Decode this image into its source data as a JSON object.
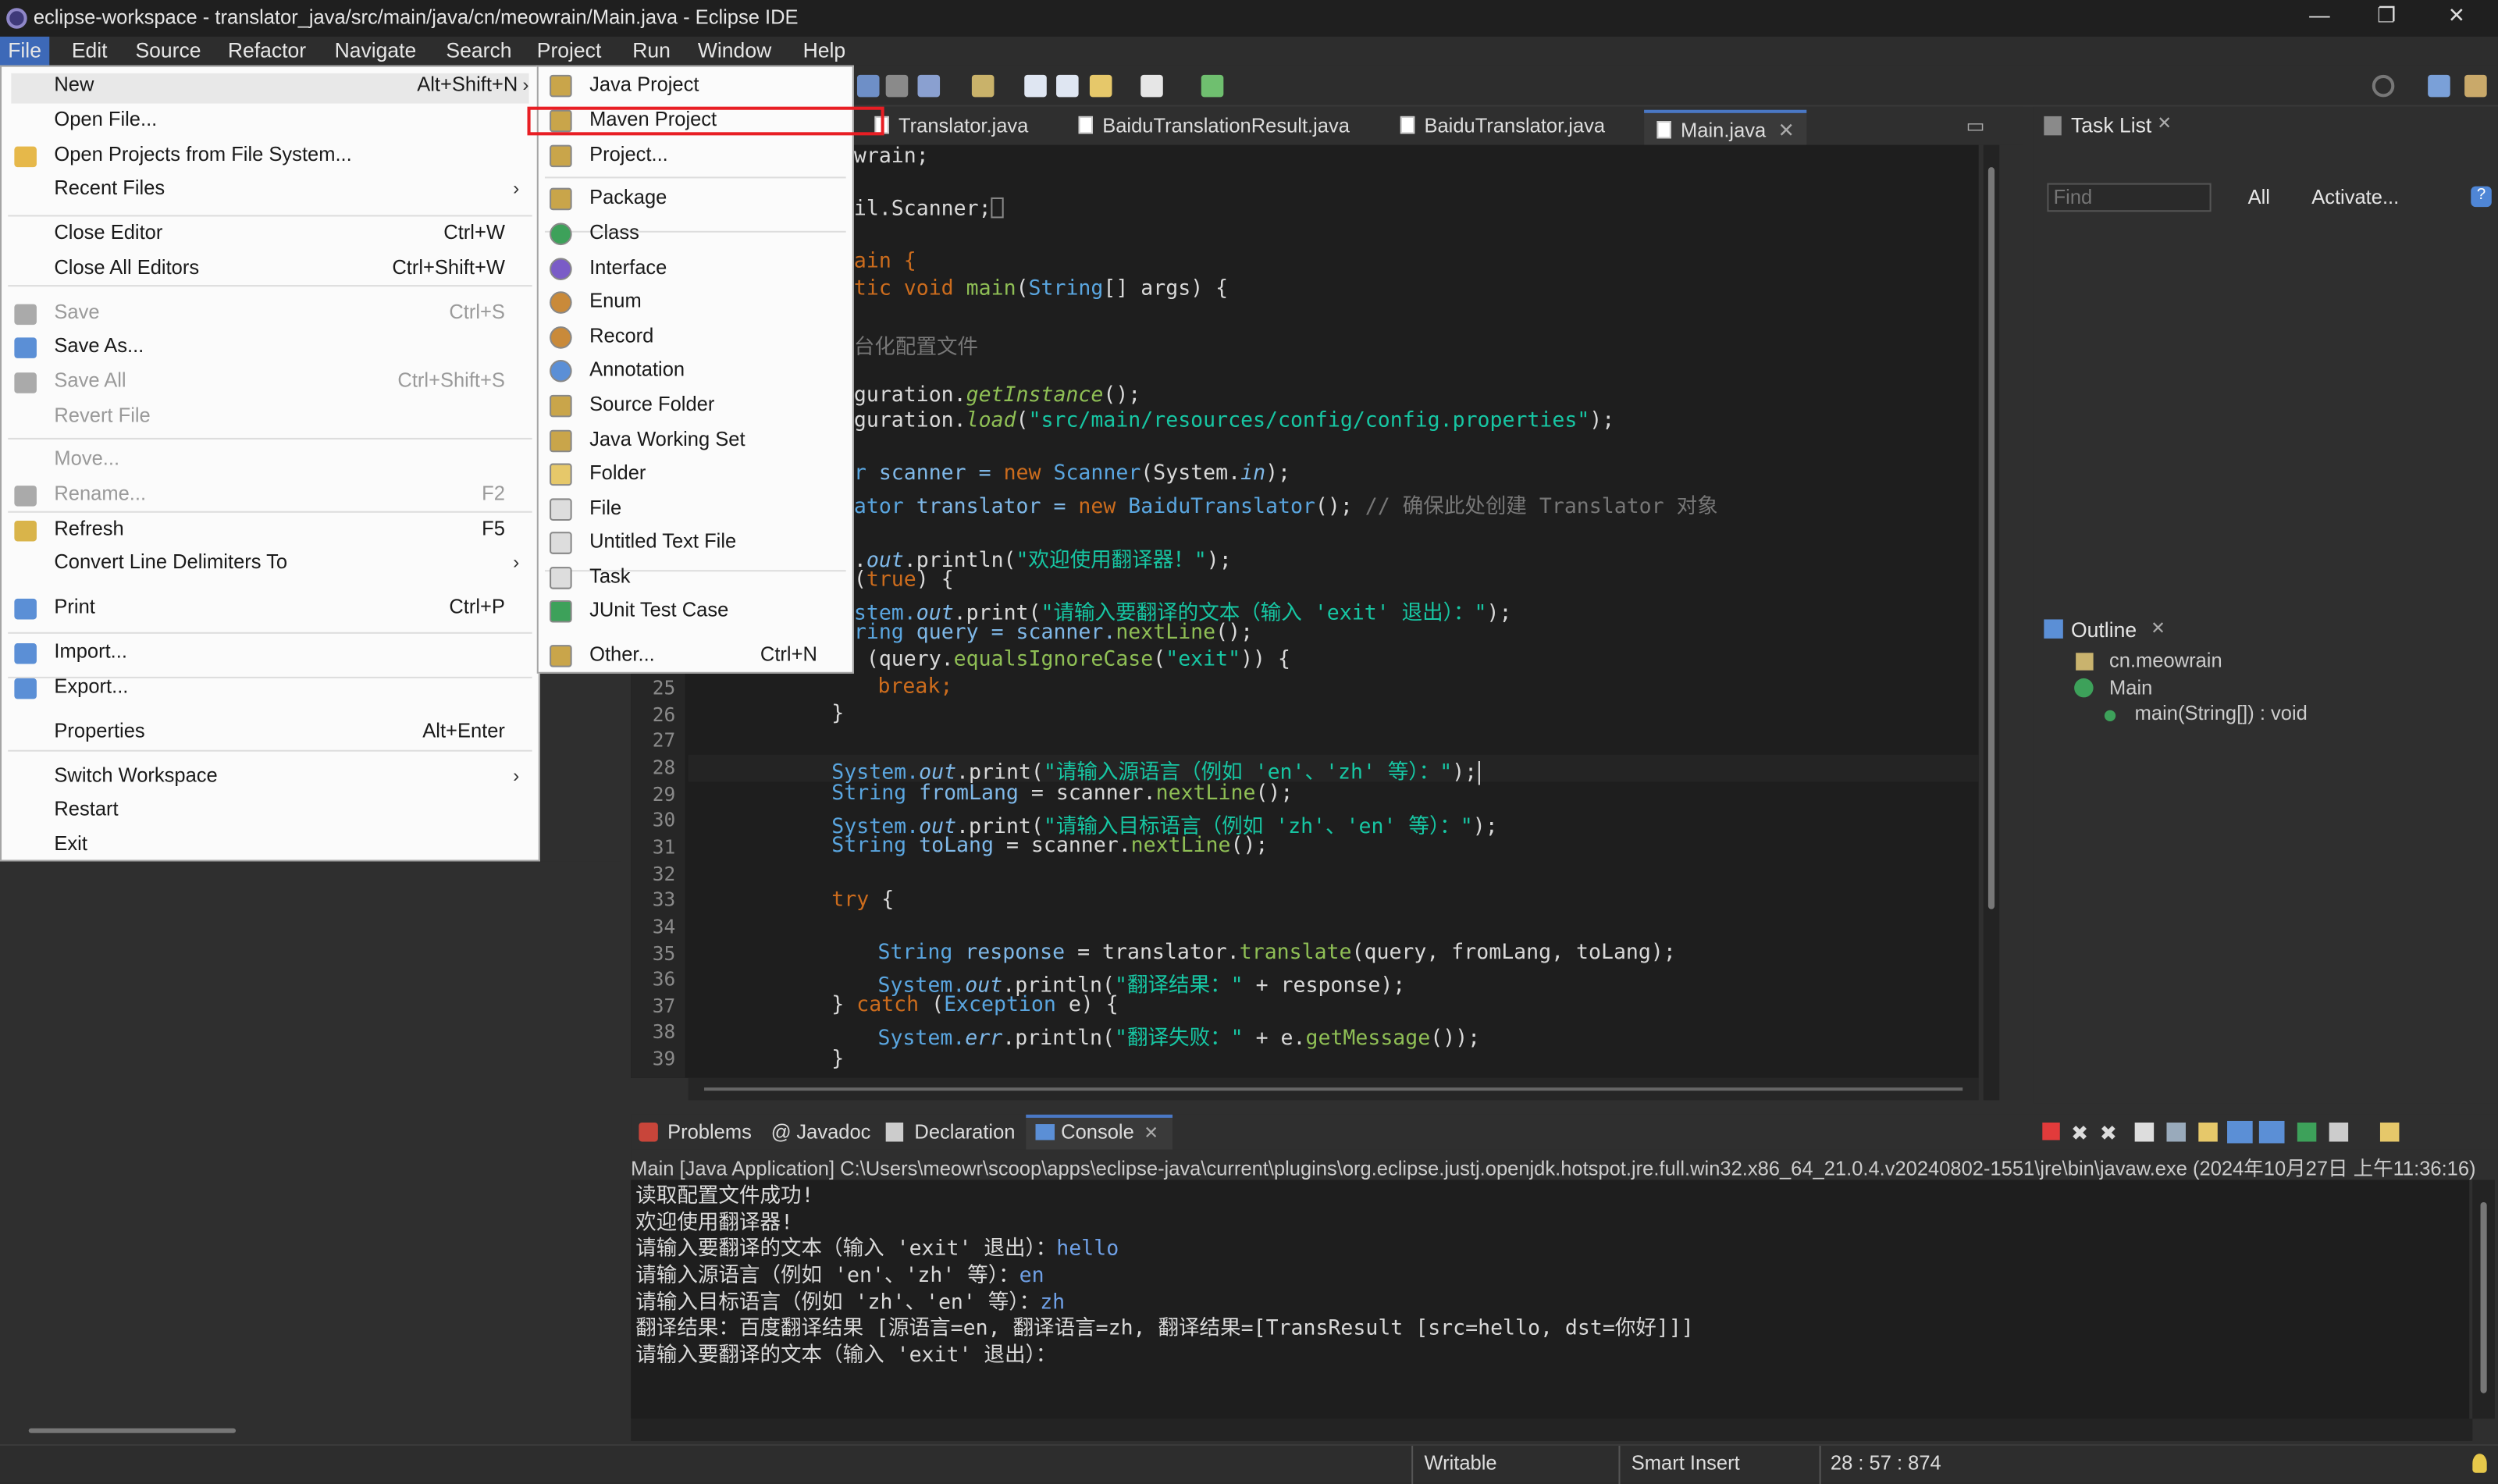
{
  "window": {
    "title": "eclipse-workspace - translator_java/src/main/java/cn/meowrain/Main.java - Eclipse IDE",
    "minimize": "—",
    "maximize": "❐",
    "close": "✕"
  },
  "menubar": [
    "File",
    "Edit",
    "Source",
    "Refactor",
    "Navigate",
    "Search",
    "Project",
    "Run",
    "Window",
    "Help"
  ],
  "editor_tabs": [
    "Translator.java",
    "BaiduTranslationResult.java",
    "BaiduTranslator.java",
    "Main.java"
  ],
  "close_glyph": "✕",
  "code": {
    "lines": [
      "25",
      "26",
      "27",
      "28",
      "29",
      "30",
      "31",
      "32",
      "33",
      "34",
      "35",
      "36",
      "37",
      "38",
      "39"
    ],
    "fragments": {
      "l1": "wrain;",
      "l2": "il.Scanner;",
      "l3a": "ain {",
      "l3b_kw": "tic void ",
      "l3b_fn": "main",
      "l3b_rest": "(",
      "l3b_ty": "String",
      "l3b_rest2": "[] args) {",
      "l4": "台化配置文件",
      "l5a": "guration.",
      "l5b": "getInstance",
      "l5c": "();",
      "l6a": "guration.",
      "l6b": "load",
      "l6c": "(",
      "l6d": "\"src/main/resources/config/config.properties\"",
      "l6e": ");",
      "l7a": "r ",
      "l7b": "scanner = ",
      "l7c": "new ",
      "l7d": "Scanner",
      "l7e": "(System.",
      "l7f": "in",
      "l7g": ");",
      "l8a": "ator ",
      "l8b": "translator = ",
      "l8c": "new ",
      "l8d": "BaiduTranslator",
      "l8e": "(); ",
      "l8f": "// 确保此处创建 Translator 对象",
      "l9a": ".",
      "l9b": "out",
      "l9c": ".println(",
      "l9d": "\"欢迎使用翻译器！\"",
      "l9e": ");",
      "l10a": "(",
      "l10b": "true",
      "l10c": ") {",
      "l11a": "stem.",
      "l11b": "out",
      "l11c": ".print(",
      "l11d": "\"请输入要翻译的文本（输入 'exit' 退出）：\"",
      "l11e": ");",
      "l12a": "ring ",
      "l12b": "query = scanner.",
      "l12c": "nextLine",
      "l12d": "();",
      "l13a": " (query.",
      "l13b": "equalsIgnoreCase",
      "l13c": "(",
      "l13d": "\"exit\"",
      "l13e": ")) {",
      "l14": "break;",
      "l15": "}",
      "l17a": "System.",
      "l17b": "out",
      "l17c": ".print(",
      "l17d": "\"请输入源语言（例如 'en'、'zh' 等）：\"",
      "l17e": ");",
      "l18a": "String ",
      "l18b": "fromLang",
      "l18c": " = scanner.",
      "l18d": "nextLine",
      "l18e": "();",
      "l19a": "System.",
      "l19b": "out",
      "l19c": ".print(",
      "l19d": "\"请输入目标语言（例如 'zh'、'en' 等）：\"",
      "l19e": ");",
      "l20a": "String ",
      "l20b": "toLang",
      "l20c": " = scanner.",
      "l20d": "nextLine",
      "l20e": "();",
      "l22a": "try ",
      "l22b": "{",
      "l24a": "String ",
      "l24b": "response",
      "l24c": " = translator.",
      "l24d": "translate",
      "l24e": "(query, fromLang, toLang);",
      "l25a": "System.",
      "l25b": "out",
      "l25c": ".println(",
      "l25d": "\"翻译结果：\"",
      "l25e": " + response);",
      "l26a": "} ",
      "l26b": "catch ",
      "l26c": "(",
      "l26d": "Exception ",
      "l26e": "e) {",
      "l27a": "System.",
      "l27b": "err",
      "l27c": ".println(",
      "l27d": "\"翻译失败：\"",
      "l27e": " + e.",
      "l27f": "getMessage",
      "l27g": "());",
      "l28": "}"
    }
  },
  "task_list": {
    "title": "Task List",
    "find_placeholder": "Find",
    "all": "All",
    "activate": "Activate..."
  },
  "outline": {
    "title": "Outline",
    "package": "cn.meowrain",
    "class": "Main",
    "method": "main(String[]) : void"
  },
  "console": {
    "tabs": [
      "Problems",
      "Javadoc",
      "Declaration",
      "Console"
    ],
    "header": "Main [Java Application] C:\\Users\\meowr\\scoop\\apps\\eclipse-java\\current\\plugins\\org.eclipse.justj.openjdk.hotspot.jre.full.win32.x86_64_21.0.4.v20240802-1551\\jre\\bin\\javaw.exe  (2024年10月27日 上午11:36:16)",
    "lines": [
      {
        "text": "读取配置文件成功!",
        "input": ""
      },
      {
        "text": "欢迎使用翻译器!",
        "input": ""
      },
      {
        "text": "请输入要翻译的文本（输入 'exit' 退出）：",
        "input": "hello"
      },
      {
        "text": "请输入源语言（例如 'en'、'zh' 等）：",
        "input": "en"
      },
      {
        "text": "请输入目标语言（例如 'zh'、'en' 等）：",
        "input": "zh"
      },
      {
        "text": "翻译结果：百度翻译结果 [源语言=en, 翻译语言=zh, 翻译结果=[TransResult [src=hello, dst=你好]]]",
        "input": ""
      },
      {
        "text": "请输入要翻译的文本（输入 'exit' 退出）：",
        "input": ""
      }
    ]
  },
  "status": {
    "writable": "Writable",
    "insert_mode": "Smart Insert",
    "position": "28 : 57 : 874"
  },
  "file_menu": [
    {
      "label": "New",
      "key": "Alt+Shift+N",
      "arrow": "›"
    },
    {
      "label": "Open File..."
    },
    {
      "label": "Open Projects from File System..."
    },
    {
      "label": "Recent Files",
      "arrow": "›"
    },
    {
      "label": "Close Editor",
      "key": "Ctrl+W"
    },
    {
      "label": "Close All Editors",
      "key": "Ctrl+Shift+W"
    },
    {
      "label": "Save",
      "key": "Ctrl+S"
    },
    {
      "label": "Save As..."
    },
    {
      "label": "Save All",
      "key": "Ctrl+Shift+S"
    },
    {
      "label": "Revert File"
    },
    {
      "label": "Move..."
    },
    {
      "label": "Rename...",
      "key": "F2"
    },
    {
      "label": "Refresh",
      "key": "F5"
    },
    {
      "label": "Convert Line Delimiters To",
      "arrow": "›"
    },
    {
      "label": "Print",
      "key": "Ctrl+P"
    },
    {
      "label": "Import..."
    },
    {
      "label": "Export..."
    },
    {
      "label": "Properties",
      "key": "Alt+Enter"
    },
    {
      "label": "Switch Workspace",
      "arrow": "›"
    },
    {
      "label": "Restart"
    },
    {
      "label": "Exit"
    }
  ],
  "new_menu": [
    {
      "label": "Java Project"
    },
    {
      "label": "Maven Project"
    },
    {
      "label": "Project..."
    },
    {
      "label": "Package"
    },
    {
      "label": "Class"
    },
    {
      "label": "Interface"
    },
    {
      "label": "Enum"
    },
    {
      "label": "Record"
    },
    {
      "label": "Annotation"
    },
    {
      "label": "Source Folder"
    },
    {
      "label": "Java Working Set"
    },
    {
      "label": "Folder"
    },
    {
      "label": "File"
    },
    {
      "label": "Untitled Text File"
    },
    {
      "label": "Task"
    },
    {
      "label": "JUnit Test Case"
    },
    {
      "label": "Other...",
      "key": "Ctrl+N"
    }
  ],
  "colors": {
    "accent": "#3d69b8",
    "highlight_box": "#e81e24",
    "menu_bg": "#fbfbfb",
    "editor_bg": "#1e1e1e"
  }
}
